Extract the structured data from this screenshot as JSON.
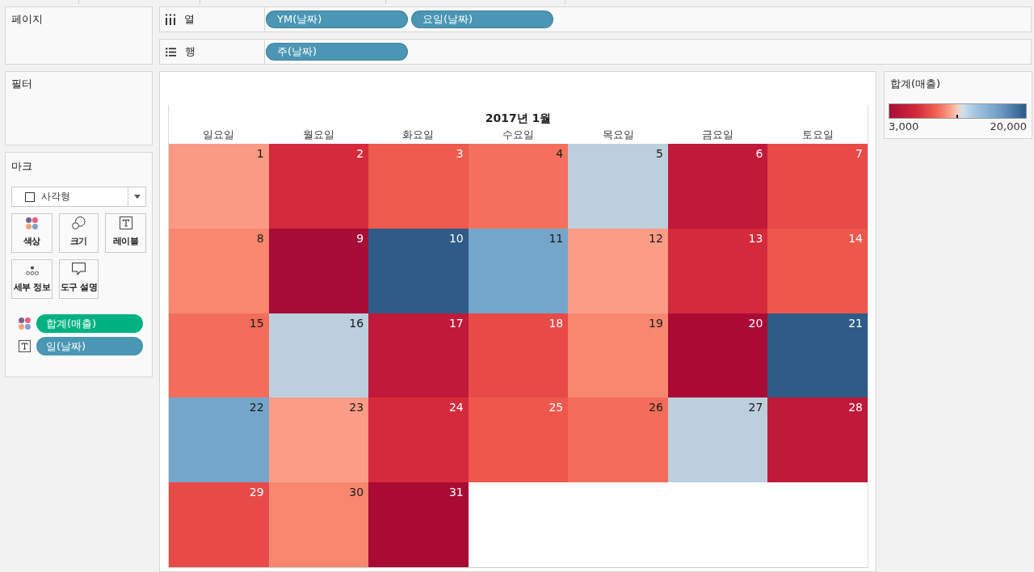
{
  "pages_panel": {
    "title": "페이지"
  },
  "shelves": [
    {
      "kind": "columns",
      "label": "열",
      "pills": [
        {
          "label": "YM(날짜)"
        },
        {
          "label": "요일(날짜)"
        }
      ]
    },
    {
      "kind": "rows",
      "label": "행",
      "pills": [
        {
          "label": "주(날짜)"
        }
      ]
    }
  ],
  "filters_panel": {
    "title": "필터"
  },
  "marks_panel": {
    "title": "마크",
    "mark_type": "사각형",
    "cards": [
      {
        "kind": "color",
        "label": "색상"
      },
      {
        "kind": "size",
        "label": "크기"
      },
      {
        "kind": "label",
        "label": "레이블"
      },
      {
        "kind": "detail",
        "label": "세부 정보"
      },
      {
        "kind": "tooltip",
        "label": "도구 설명"
      }
    ],
    "fields": [
      {
        "kind": "color",
        "label": "합계(매출)",
        "color": "#00b281"
      },
      {
        "kind": "label",
        "label": "일(날짜)",
        "color": "#4a96b4"
      }
    ]
  },
  "view": {
    "title": "2017년 1월",
    "weekdays": [
      "일요일",
      "월요일",
      "화요일",
      "수요일",
      "목요일",
      "금요일",
      "토요일"
    ],
    "weeks": [
      {
        "days": [
          {
            "day": "1",
            "color": "#fa9a84"
          },
          {
            "day": "2",
            "color": "#d42a3c"
          },
          {
            "day": "3",
            "color": "#ee5a4c"
          },
          {
            "day": "4",
            "color": "#f4705d"
          },
          {
            "day": "5",
            "color": "#bccfdd"
          },
          {
            "day": "6",
            "color": "#c0193a"
          },
          {
            "day": "7",
            "color": "#e84a48"
          }
        ]
      },
      {
        "days": [
          {
            "day": "8",
            "color": "#f8876f"
          },
          {
            "day": "9",
            "color": "#a80d37"
          },
          {
            "day": "10",
            "color": "#2e5b88"
          },
          {
            "day": "11",
            "color": "#74a6cb"
          },
          {
            "day": "12",
            "color": "#fc9c86"
          },
          {
            "day": "13",
            "color": "#d42a3c"
          },
          {
            "day": "14",
            "color": "#ee574b"
          }
        ]
      },
      {
        "days": [
          {
            "day": "15",
            "color": "#f46c5a"
          },
          {
            "day": "16",
            "color": "#bccfdd"
          },
          {
            "day": "17",
            "color": "#c0193a"
          },
          {
            "day": "18",
            "color": "#e84a48"
          },
          {
            "day": "19",
            "color": "#f8876f"
          },
          {
            "day": "20",
            "color": "#aa0b35"
          },
          {
            "day": "21",
            "color": "#2e5b88"
          }
        ]
      },
      {
        "days": [
          {
            "day": "22",
            "color": "#74a6cb"
          },
          {
            "day": "23",
            "color": "#fc9c86"
          },
          {
            "day": "24",
            "color": "#d42a3c"
          },
          {
            "day": "25",
            "color": "#ee574b"
          },
          {
            "day": "26",
            "color": "#f46c5a"
          },
          {
            "day": "27",
            "color": "#bccfdd"
          },
          {
            "day": "28",
            "color": "#c0193a"
          }
        ]
      },
      {
        "days": [
          {
            "day": "29",
            "color": "#e84a48"
          },
          {
            "day": "30",
            "color": "#f8876f"
          },
          {
            "day": "31",
            "color": "#aa0b35"
          }
        ]
      }
    ]
  },
  "legend": {
    "title": "합계(매출)",
    "min_label": "3,000",
    "max_label": "20,000"
  }
}
